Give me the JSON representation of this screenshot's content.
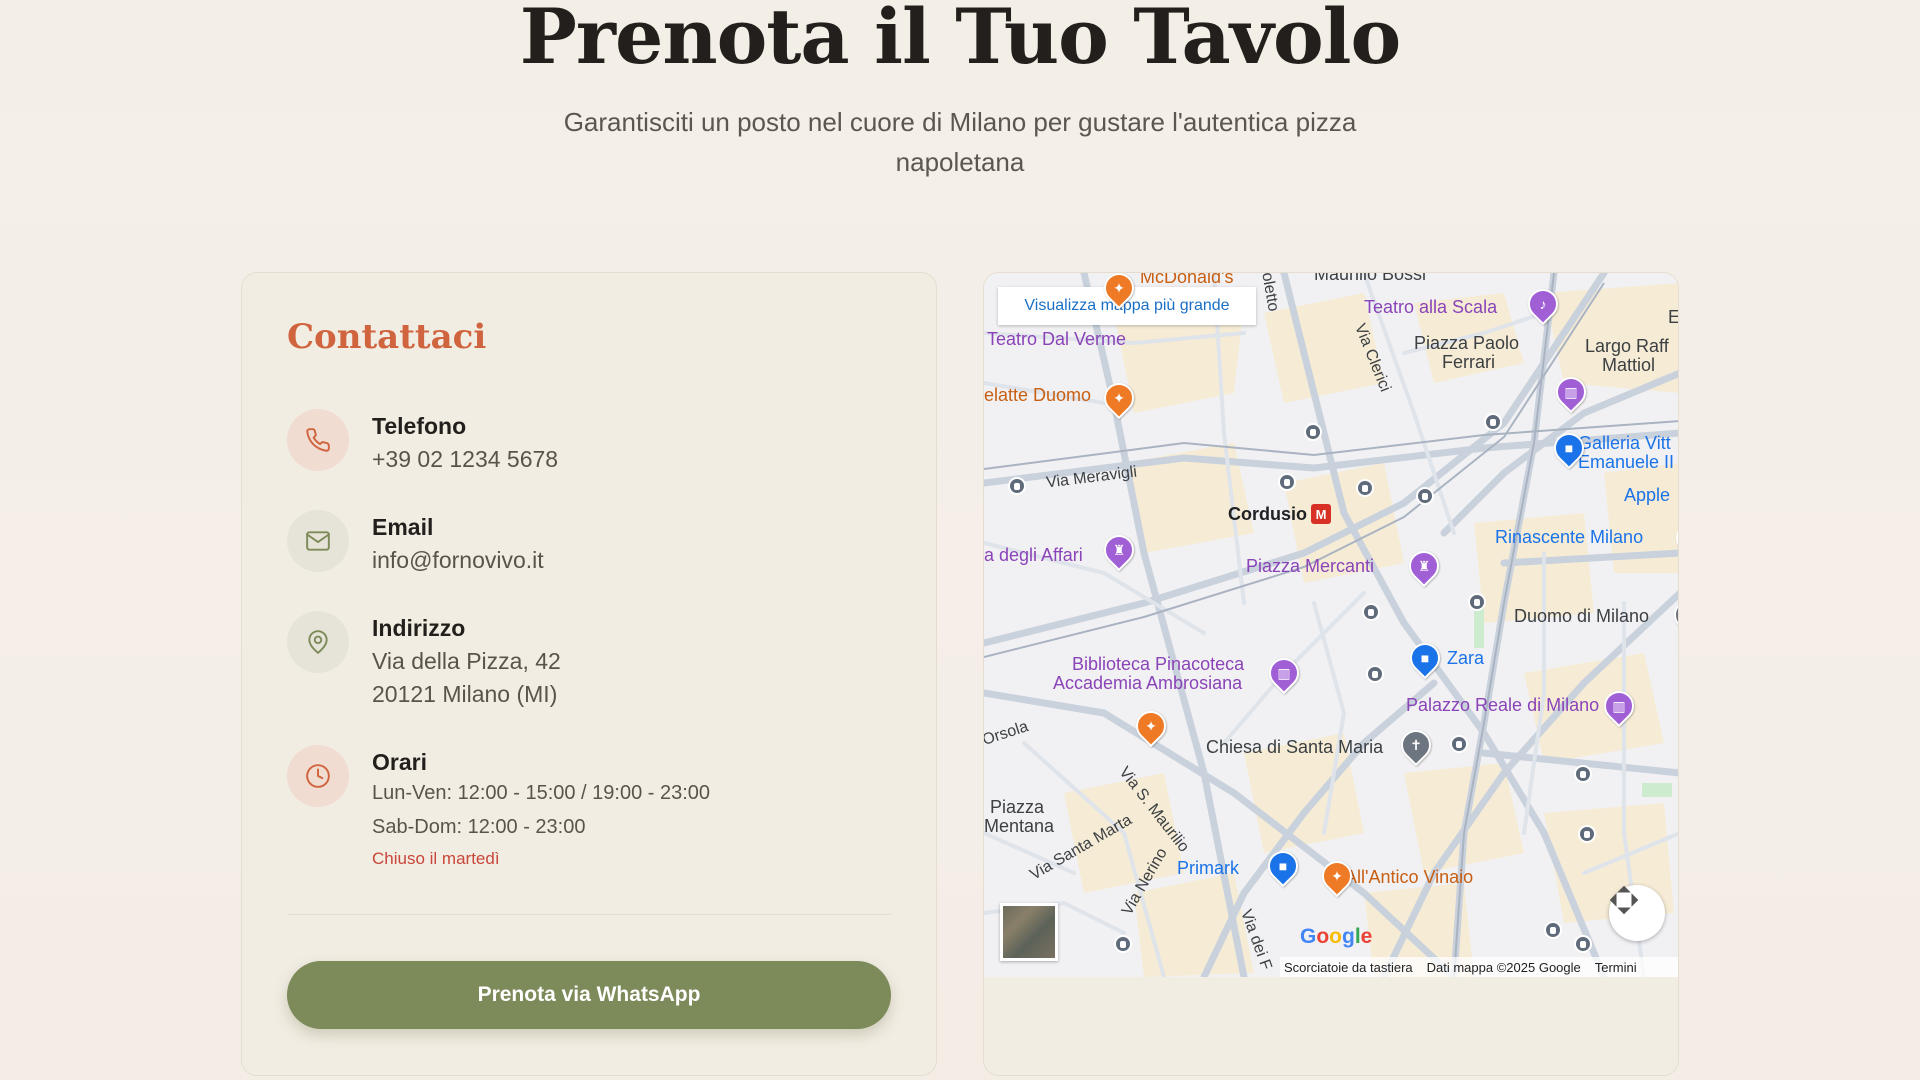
{
  "hero": {
    "title": "Prenota il Tuo Tavolo",
    "subtitle": "Garantisciti un posto nel cuore di Milano per gustare l'autentica pizza napoletana"
  },
  "contact": {
    "heading": "Contattaci",
    "phone": {
      "label": "Telefono",
      "value": "+39 02 1234 5678",
      "icon": "phone-icon"
    },
    "email": {
      "label": "Email",
      "value": "info@fornovivo.it",
      "icon": "mail-icon"
    },
    "address": {
      "label": "Indirizzo",
      "line1": "Via della Pizza, 42",
      "line2": "20121 Milano (MI)",
      "icon": "map-pin-icon"
    },
    "hours": {
      "label": "Orari",
      "weekdays": "Lun-Ven: 12:00 - 15:00 / 19:00 - 23:00",
      "weekend": "Sab-Dom: 12:00 - 23:00",
      "closed": "Chiuso il martedì",
      "icon": "clock-icon"
    },
    "whatsapp_button": "Prenota via WhatsApp"
  },
  "map": {
    "view_larger": "Visualizza mappa più grande",
    "places": {
      "mcdonalds": "McDonald's",
      "teatro_dal_verme": "Teatro Dal Verme",
      "gelatte_duomo": "elatte Duomo",
      "via_meravigli": "Via Meravigli",
      "cordusio": "Cordusio",
      "piazza_affari": "a degli Affari",
      "piazza_mercanti": "Piazza Mercanti",
      "teatro_scala": "Teatro alla Scala",
      "piazza_paolo_ferrari_1": "Piazza Paolo",
      "piazza_paolo_ferrari_2": "Ferrari",
      "largo_raffaele_1": "Largo Raff",
      "largo_raffaele_2": "Mattiol",
      "galleria_1": "Galleria Vitt",
      "galleria_2": "Emanuele II",
      "apple": "Apple",
      "rinascente": "Rinascente Milano",
      "duomo": "Duomo di Milano",
      "zara": "Zara",
      "biblioteca_1": "Biblioteca Pinacoteca",
      "biblioteca_2": "Accademia Ambrosiana",
      "palazzo_reale": "Palazzo Reale di Milano",
      "chiesa": "Chiesa di Santa Maria",
      "orsola": "Orsola",
      "piazza_mentana_1": "Piazza",
      "piazza_mentana_2": "Mentana",
      "via_s_maurilio": "Via S. Maurilio",
      "via_santa_marta": "Via Santa Marta",
      "via_nerino": "Via Nerino",
      "primark": "Primark",
      "antico_vinaio": "All'Antico Vinaio",
      "via_clerici": "Via Clerici",
      "maurilio_bossi": "Maurilio Bossi",
      "via_dei": "Via dei F",
      "letto": "oletto",
      "e_label": "E"
    },
    "google": "Google",
    "shortcuts": "Scorciatoie da tastiera",
    "map_data": "Dati mappa ©2025 Google",
    "terms": "Termini",
    "metro_glyph": "M",
    "colors": {
      "poi_purple": "#a15fd6",
      "shop_blue": "#1a73e8",
      "food_orange": "#ee7a26"
    }
  },
  "colors": {
    "accent": "#d0643f",
    "button_green": "#7d8a59",
    "closed_red": "#c8463a"
  }
}
